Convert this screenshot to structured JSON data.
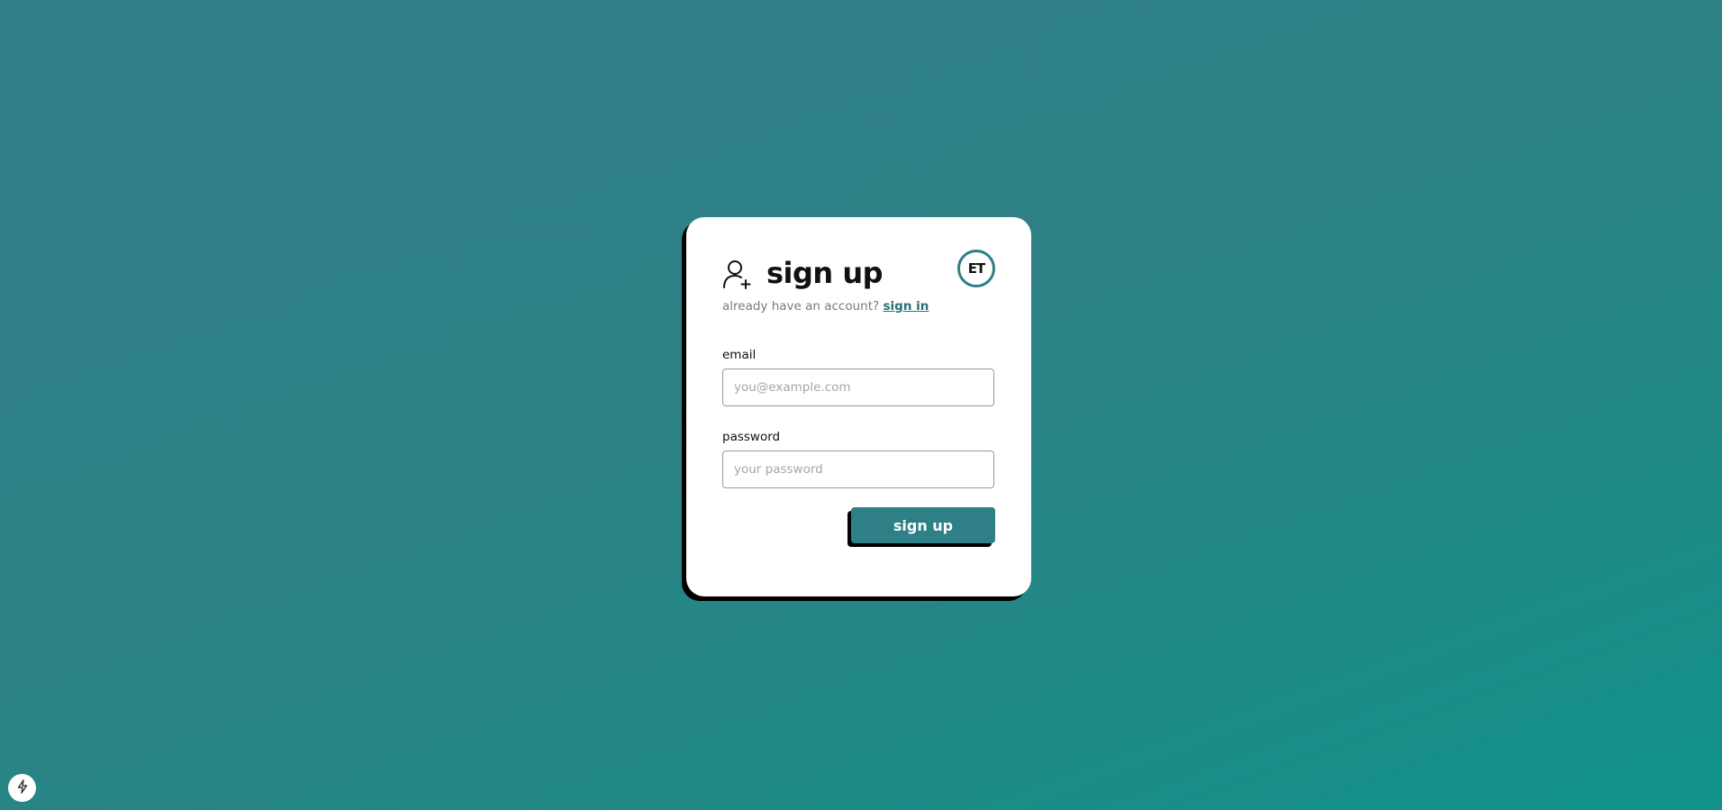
{
  "colors": {
    "background_start": "#2e7f86",
    "background_end": "#10938a",
    "accent": "#2e7f86",
    "link": "#2a6f7a",
    "card": "#ffffff",
    "shadow": "#000000"
  },
  "signup_card": {
    "icon": "user-plus-icon",
    "title": "sign up",
    "badge_text": "ET",
    "subtitle_text": "already have an account?",
    "signin_link": "sign in",
    "email": {
      "label": "email",
      "placeholder": "you@example.com",
      "value": ""
    },
    "password": {
      "label": "password",
      "placeholder": "your password",
      "value": ""
    },
    "submit_label": "sign up"
  },
  "corner_button": {
    "icon": "lightning-bolt-icon"
  }
}
